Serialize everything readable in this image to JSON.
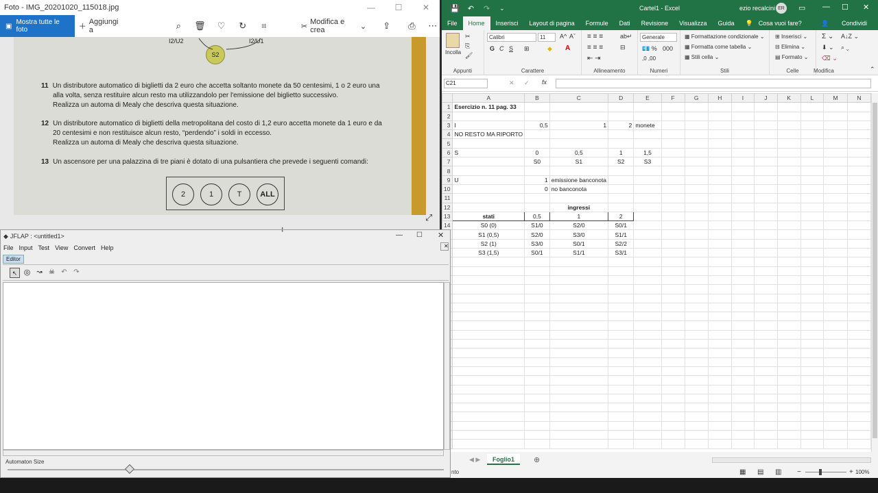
{
  "photos": {
    "title": "Foto - IMG_20201020_115018.jpg",
    "show_all": "Mostra tutte le foto",
    "add_to": "Aggiungi a",
    "edit_create": "Modifica e crea",
    "diagram": {
      "lbl_left": "I2/U2",
      "state": "S2",
      "lbl_right": "I2/U1"
    },
    "exercises": [
      {
        "num": "11",
        "lines": [
          "Un distributore automatico di biglietti da 2 euro che accetta soltanto monete da 50 centesimi, 1 o 2 euro una",
          "alla volta, senza restituire alcun resto ma utilizzandolo per l'emissione del biglietto successivo.",
          "Realizza un automa di Mealy che descriva questa situazione."
        ]
      },
      {
        "num": "12",
        "lines": [
          "Un distributore automatico di biglietti della metropolitana del costo di 1,2 euro accetta monete da 1 euro e da",
          "20 centesimi e non restituisce alcun resto, “perdendo” i soldi in eccesso.",
          "Realizza un automa di Mealy che descriva questa situazione."
        ]
      },
      {
        "num": "13",
        "lines": [
          "Un ascensore per una palazzina di tre piani è dotato di una pulsantiera che prevede i seguenti comandi:"
        ]
      }
    ],
    "buttons": [
      "2",
      "1",
      "T",
      "ALL"
    ]
  },
  "excel": {
    "title": "Cartel1 - Excel",
    "user": "ezio recalcini",
    "avatar": "ER",
    "tabs": [
      "File",
      "Home",
      "Inserisci",
      "Layout di pagina",
      "Formule",
      "Dati",
      "Revisione",
      "Visualizza",
      "Guida"
    ],
    "tell_me": "Cosa vuoi fare?",
    "share": "Condividi",
    "ribbon": {
      "paste": "Incolla",
      "clipboard": "Appunti",
      "font_name": "Calibri",
      "font_size": "11",
      "font_group": "Carattere",
      "align_group": "Allineamento",
      "number_format": "Generale",
      "number_group": "Numeri",
      "cond_format": "Formattazione condizionale",
      "format_table": "Formatta come tabella",
      "cell_styles": "Stili cella",
      "styles_group": "Stili",
      "insert": "Inserisci",
      "delete": "Elimina",
      "format": "Formato",
      "cells_group": "Celle",
      "edit_group": "Modifica"
    },
    "name_box": "C21",
    "fx": "fx",
    "columns": [
      "A",
      "B",
      "C",
      "D",
      "E",
      "F",
      "G",
      "H",
      "I",
      "J",
      "K",
      "L",
      "M",
      "N"
    ],
    "rows": [
      [
        "Esercizio n. 11 pag. 33",
        "",
        "",
        "",
        ""
      ],
      [
        "",
        "",
        "",
        "",
        ""
      ],
      [
        "I",
        "0,5",
        "1",
        "2",
        "monete"
      ],
      [
        "NO RESTO MA RIPORTO",
        "",
        "",
        "",
        ""
      ],
      [
        "",
        "",
        "",
        "",
        ""
      ],
      [
        "S",
        "0",
        "0,5",
        "1",
        "1,5"
      ],
      [
        "",
        "S0",
        "S1",
        "S2",
        "S3"
      ],
      [
        "",
        "",
        "",
        "",
        ""
      ],
      [
        "U",
        "1",
        "emissione banconota",
        "",
        ""
      ],
      [
        "",
        "0",
        "no banconota",
        "",
        ""
      ],
      [
        "",
        "",
        "",
        "",
        ""
      ],
      [
        "",
        "",
        "ingressi",
        "",
        ""
      ],
      [
        "stati",
        "0,5",
        "1",
        "2",
        ""
      ],
      [
        "S0 (0)",
        "S1/0",
        "S2/0",
        "S0/1",
        ""
      ],
      [
        "S1 (0,5)",
        "S2/0",
        "S3/0",
        "S1/1",
        ""
      ],
      [
        "S2 (1)",
        "S3/0",
        "S0/1",
        "S2/2",
        ""
      ],
      [
        "S3 (1,5)",
        "S0/1",
        "S1/1",
        "S3/1",
        ""
      ]
    ],
    "sheet_tab": "Foglio1",
    "status": "nto",
    "zoom": "100%"
  },
  "jflap": {
    "title": "JFLAP : <untitled1>",
    "menu": [
      "File",
      "Input",
      "Test",
      "View",
      "Convert",
      "Help"
    ],
    "tab": "Editor",
    "size_label": "Automaton Size",
    "size_value": 0.28
  }
}
